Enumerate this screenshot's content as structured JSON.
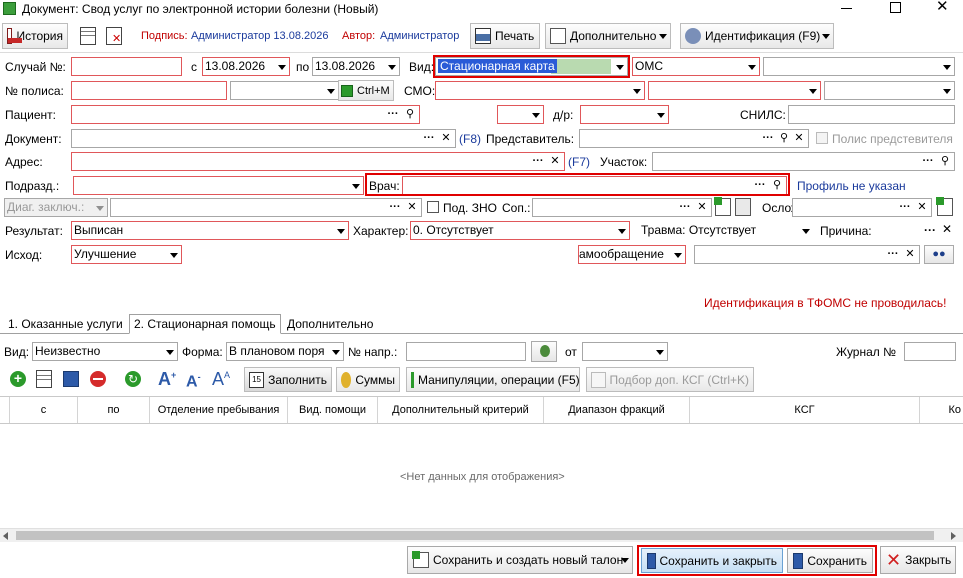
{
  "window": {
    "title": "Документ: Свод услуг по электронной истории болезни (Новый)"
  },
  "toolbar": {
    "history": "История",
    "signature_label": "Подпись:",
    "signature_value": "Администратор 13.08.2026",
    "author_label": "Автор:",
    "author_value": "Администратор",
    "print": "Печать",
    "more": "Дополнительно",
    "identify": "Идентификация (F9)"
  },
  "form": {
    "case_label": "Случай №:",
    "from_label": "с",
    "date_from": "13.08.2026",
    "to_label": "по",
    "date_to": "13.08.2026",
    "kind_label": "Вид:",
    "kind_value": "Стационарная карта",
    "fund_value": "ОМС",
    "policy_label": "№ полиса:",
    "ctrl_m": "Ctrl+M",
    "smo_label": "СМО:",
    "patient_label": "Пациент:",
    "dob_label": "д/р:",
    "snils_label": "СНИЛС:",
    "document_label": "Документ:",
    "f8": "(F8)",
    "representative_label": "Представитель:",
    "rep_policy_label": "Полис предстевителя",
    "address_label": "Адрес:",
    "f7": "(F7)",
    "district_label": "Участок:",
    "subdivision_label": "Подразд.:",
    "doctor_label": "Врач:",
    "profile_text": "Профиль не указан",
    "diag_label": "Диаг. заключ.:",
    "zno_label": "Под. ЗНО",
    "concomitant_label": "Соп.:",
    "complication_label": "Ослож:",
    "result_label": "Результат:",
    "result_value": "Выписан",
    "character_label": "Характер:",
    "character_value": "0. Отсутствует",
    "trauma_label": "Травма: Отсутствует",
    "reason_label": "Причина:",
    "outcome_label": "Исход:",
    "outcome_value": "Улучшение",
    "self_referral": "амообращение",
    "tfoms_warning": "Идентификация в ТФОМС не проводилась!"
  },
  "tabs": [
    "1. Оказанные услуги",
    "2. Стационарная помощь",
    "Дополнительно"
  ],
  "tab_panel": {
    "kind_label": "Вид:",
    "kind_value": "Неизвестно",
    "form_label": "Форма:",
    "form_value": "В плановом поря",
    "ref_label": "№ напр.:",
    "from_label": "от",
    "journal_label": "Журнал №",
    "fill_btn": "Заполнить",
    "sums_btn": "Суммы",
    "manip_btn": "Манипуляции, операции (F5)",
    "ksg_btn": "Подбор доп. КСГ (Ctrl+K)"
  },
  "grid": {
    "columns": [
      "с",
      "по",
      "Отделение пребывания",
      "Вид. помощи",
      "Дополнительный критерий",
      "Диапазон фракций",
      "КСГ",
      "Ко"
    ],
    "empty": "<Нет данных для отображения>"
  },
  "footer": {
    "save_new": "Сохранить и создать новый талон",
    "save_close": "Сохранить и закрыть",
    "save": "Сохранить",
    "close": "Закрыть"
  },
  "colors": {
    "link_blue": "#1a3a9c",
    "warning_red": "#c00000",
    "highlight_red": "#e00000",
    "selection": "#2a5bd7"
  }
}
